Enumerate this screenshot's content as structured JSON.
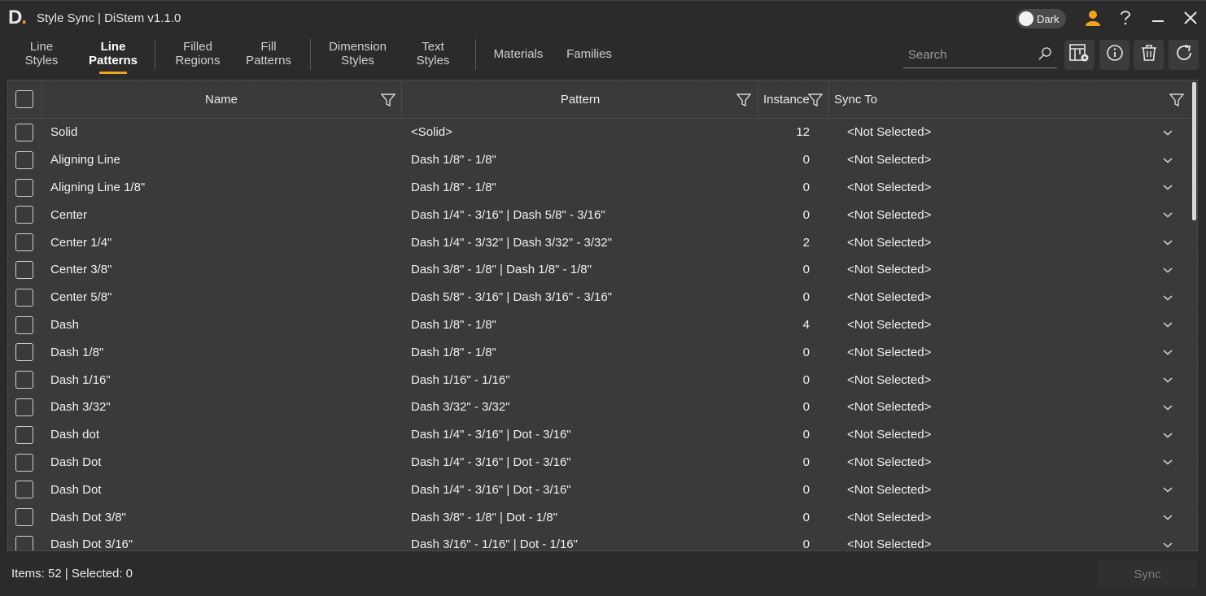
{
  "app": {
    "logo_letter": "D",
    "logo_dot": ".",
    "title": "Style Sync | DiStem v1.1.0",
    "theme_toggle_label": "Dark",
    "accent_color": "#f2a51a"
  },
  "tabs": [
    {
      "label": "Line\nStyles",
      "active": false
    },
    {
      "label": "Line\nPatterns",
      "active": true
    },
    {
      "label": "Filled\nRegions",
      "active": false
    },
    {
      "label": "Fill\nPatterns",
      "active": false
    },
    {
      "label": "Dimension\nStyles",
      "active": false
    },
    {
      "label": "Text\nStyles",
      "active": false
    },
    {
      "label": "Materials",
      "active": false
    },
    {
      "label": "Families",
      "active": false
    }
  ],
  "search": {
    "placeholder": "Search",
    "value": ""
  },
  "toolbar_icons": [
    "column-settings-icon",
    "info-icon",
    "trash-icon",
    "refresh-icon"
  ],
  "grid": {
    "columns": {
      "name": "Name",
      "pattern": "Pattern",
      "instance": "Instance",
      "sync_to": "Sync To"
    },
    "rows": [
      {
        "name": "Solid",
        "pattern": "<Solid>",
        "instance": "12",
        "sync_to": "<Not Selected>"
      },
      {
        "name": "Aligning Line",
        "pattern": "Dash 1/8\" - 1/8\"",
        "instance": "0",
        "sync_to": "<Not Selected>"
      },
      {
        "name": "Aligning Line 1/8\"",
        "pattern": "Dash 1/8\" - 1/8\"",
        "instance": "0",
        "sync_to": "<Not Selected>"
      },
      {
        "name": "Center",
        "pattern": "Dash 1/4\" - 3/16\" | Dash 5/8\" - 3/16\"",
        "instance": "0",
        "sync_to": "<Not Selected>"
      },
      {
        "name": "Center 1/4\"",
        "pattern": "Dash 1/4\" - 3/32\" | Dash 3/32\" - 3/32\"",
        "instance": "2",
        "sync_to": "<Not Selected>"
      },
      {
        "name": "Center 3/8\"",
        "pattern": "Dash 3/8\" - 1/8\" | Dash 1/8\" - 1/8\"",
        "instance": "0",
        "sync_to": "<Not Selected>"
      },
      {
        "name": "Center 5/8\"",
        "pattern": "Dash 5/8\" - 3/16\" | Dash 3/16\" - 3/16\"",
        "instance": "0",
        "sync_to": "<Not Selected>"
      },
      {
        "name": "Dash",
        "pattern": "Dash 1/8\" - 1/8\"",
        "instance": "4",
        "sync_to": "<Not Selected>"
      },
      {
        "name": "Dash 1/8\"",
        "pattern": "Dash 1/8\" - 1/8\"",
        "instance": "0",
        "sync_to": "<Not Selected>"
      },
      {
        "name": "Dash 1/16\"",
        "pattern": "Dash 1/16\" - 1/16\"",
        "instance": "0",
        "sync_to": "<Not Selected>"
      },
      {
        "name": "Dash 3/32\"",
        "pattern": "Dash 3/32\" - 3/32\"",
        "instance": "0",
        "sync_to": "<Not Selected>"
      },
      {
        "name": "Dash dot",
        "pattern": "Dash 1/4\" - 3/16\" | Dot - 3/16\"",
        "instance": "0",
        "sync_to": "<Not Selected>"
      },
      {
        "name": "Dash Dot",
        "pattern": "Dash 1/4\" - 3/16\" | Dot - 3/16\"",
        "instance": "0",
        "sync_to": "<Not Selected>"
      },
      {
        "name": "Dash Dot",
        "pattern": "Dash 1/4\" - 3/16\" | Dot - 3/16\"",
        "instance": "0",
        "sync_to": "<Not Selected>"
      },
      {
        "name": "Dash Dot 3/8\"",
        "pattern": "Dash 3/8\" - 1/8\" | Dot - 1/8\"",
        "instance": "0",
        "sync_to": "<Not Selected>"
      },
      {
        "name": "Dash Dot 3/16\"",
        "pattern": "Dash 3/16\" - 1/16\" | Dot - 1/16\"",
        "instance": "0",
        "sync_to": "<Not Selected>"
      }
    ]
  },
  "status": {
    "summary": "Items: 52 | Selected: 0",
    "sync_label": "Sync"
  }
}
